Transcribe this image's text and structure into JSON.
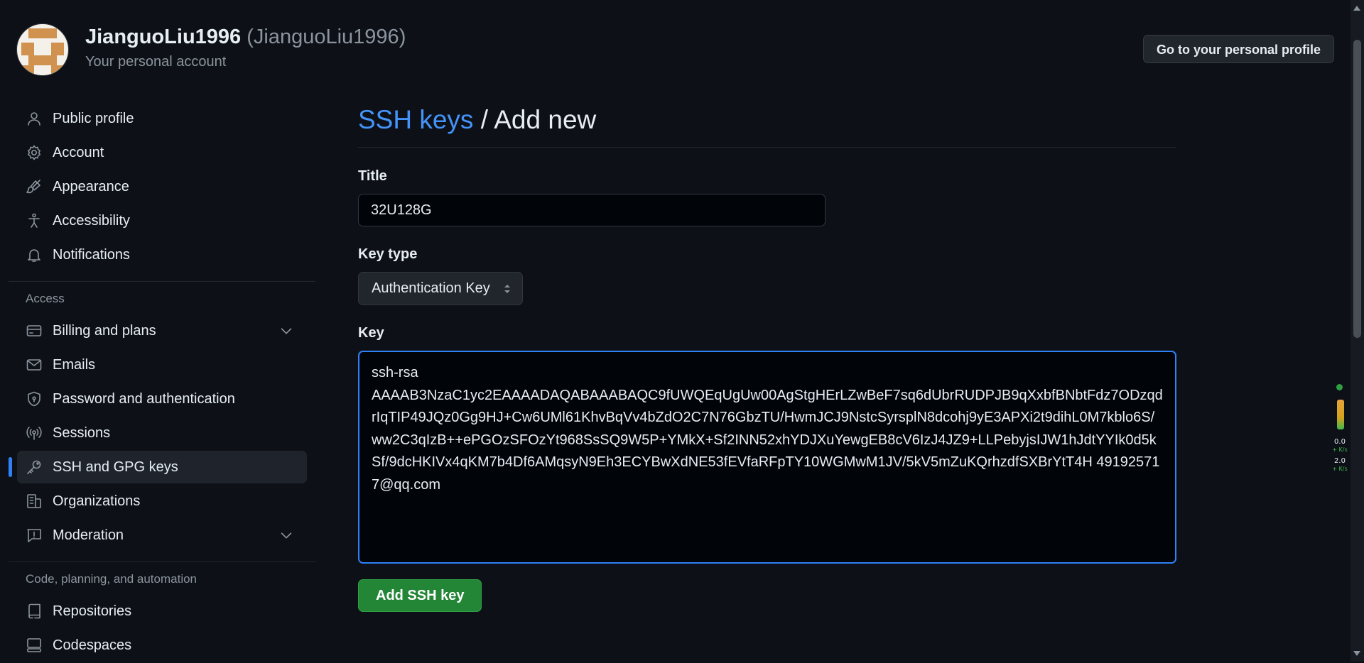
{
  "header": {
    "display_name": "JianguoLiu1996",
    "login": "(JianguoLiu1996)",
    "subtitle": "Your personal account",
    "profile_button": "Go to your personal profile"
  },
  "sidebar": {
    "items": [
      {
        "label": "Public profile",
        "icon": "person-icon"
      },
      {
        "label": "Account",
        "icon": "gear-icon"
      },
      {
        "label": "Appearance",
        "icon": "paintbrush-icon"
      },
      {
        "label": "Accessibility",
        "icon": "accessibility-icon"
      },
      {
        "label": "Notifications",
        "icon": "bell-icon"
      }
    ],
    "access_heading": "Access",
    "access_items": [
      {
        "label": "Billing and plans",
        "icon": "credit-card-icon",
        "expandable": true
      },
      {
        "label": "Emails",
        "icon": "mail-icon"
      },
      {
        "label": "Password and authentication",
        "icon": "shield-lock-icon"
      },
      {
        "label": "Sessions",
        "icon": "broadcast-icon"
      },
      {
        "label": "SSH and GPG keys",
        "icon": "key-icon",
        "active": true
      },
      {
        "label": "Organizations",
        "icon": "organization-icon"
      },
      {
        "label": "Moderation",
        "icon": "report-icon",
        "expandable": true
      }
    ],
    "code_heading": "Code, planning, and automation",
    "code_items": [
      {
        "label": "Repositories",
        "icon": "repo-icon"
      },
      {
        "label": "Codespaces",
        "icon": "codespaces-icon"
      }
    ]
  },
  "main": {
    "breadcrumb_link": "SSH keys",
    "breadcrumb_sep": "/",
    "breadcrumb_current": "Add new",
    "title_label": "Title",
    "title_value": "32U128G",
    "keytype_label": "Key type",
    "keytype_value": "Authentication Key",
    "key_label": "Key",
    "key_value": "ssh-rsa\nAAAAB3NzaC1yc2EAAAADAQABAAABAQC9fUWQEqUgUw00AgStgHErLZwBeF7sq6dUbrRUDPJB9qXxbfBNbtFdz7ODzqdrIqTIP49JQz0Gg9HJ+Cw6UMl61KhvBqVv4bZdO2C7N76GbzTU/HwmJCJ9NstcSyrsplN8dcohj9yE3APXi2t9dihL0M7kblo6S/ww2C3qIzB++ePGOzSFOzYt968SsSQ9W5P+YMkX+Sf2INN52xhYDJXuYewgEB8cV6IzJ4JZ9+LLPebyjsIJW1hJdtYYIk0d5kSf/9dcHKIVx4qKM7b4Df6AMqsyN9Eh3ECYBwXdNE53fEVfaRFpTY10WGMwM1JV/5kV5mZuKQrhzdfSXBrYtT4H 491925717@qq.com",
    "submit_label": "Add SSH key"
  },
  "net_widget": {
    "up_value": "0.0",
    "up_unit": "+ K/s",
    "down_value": "2.0",
    "down_unit": "+ K/s"
  },
  "colors": {
    "background": "#0d1117",
    "accent": "#2f81f7",
    "link": "#4493f8",
    "primary_button": "#238636"
  }
}
